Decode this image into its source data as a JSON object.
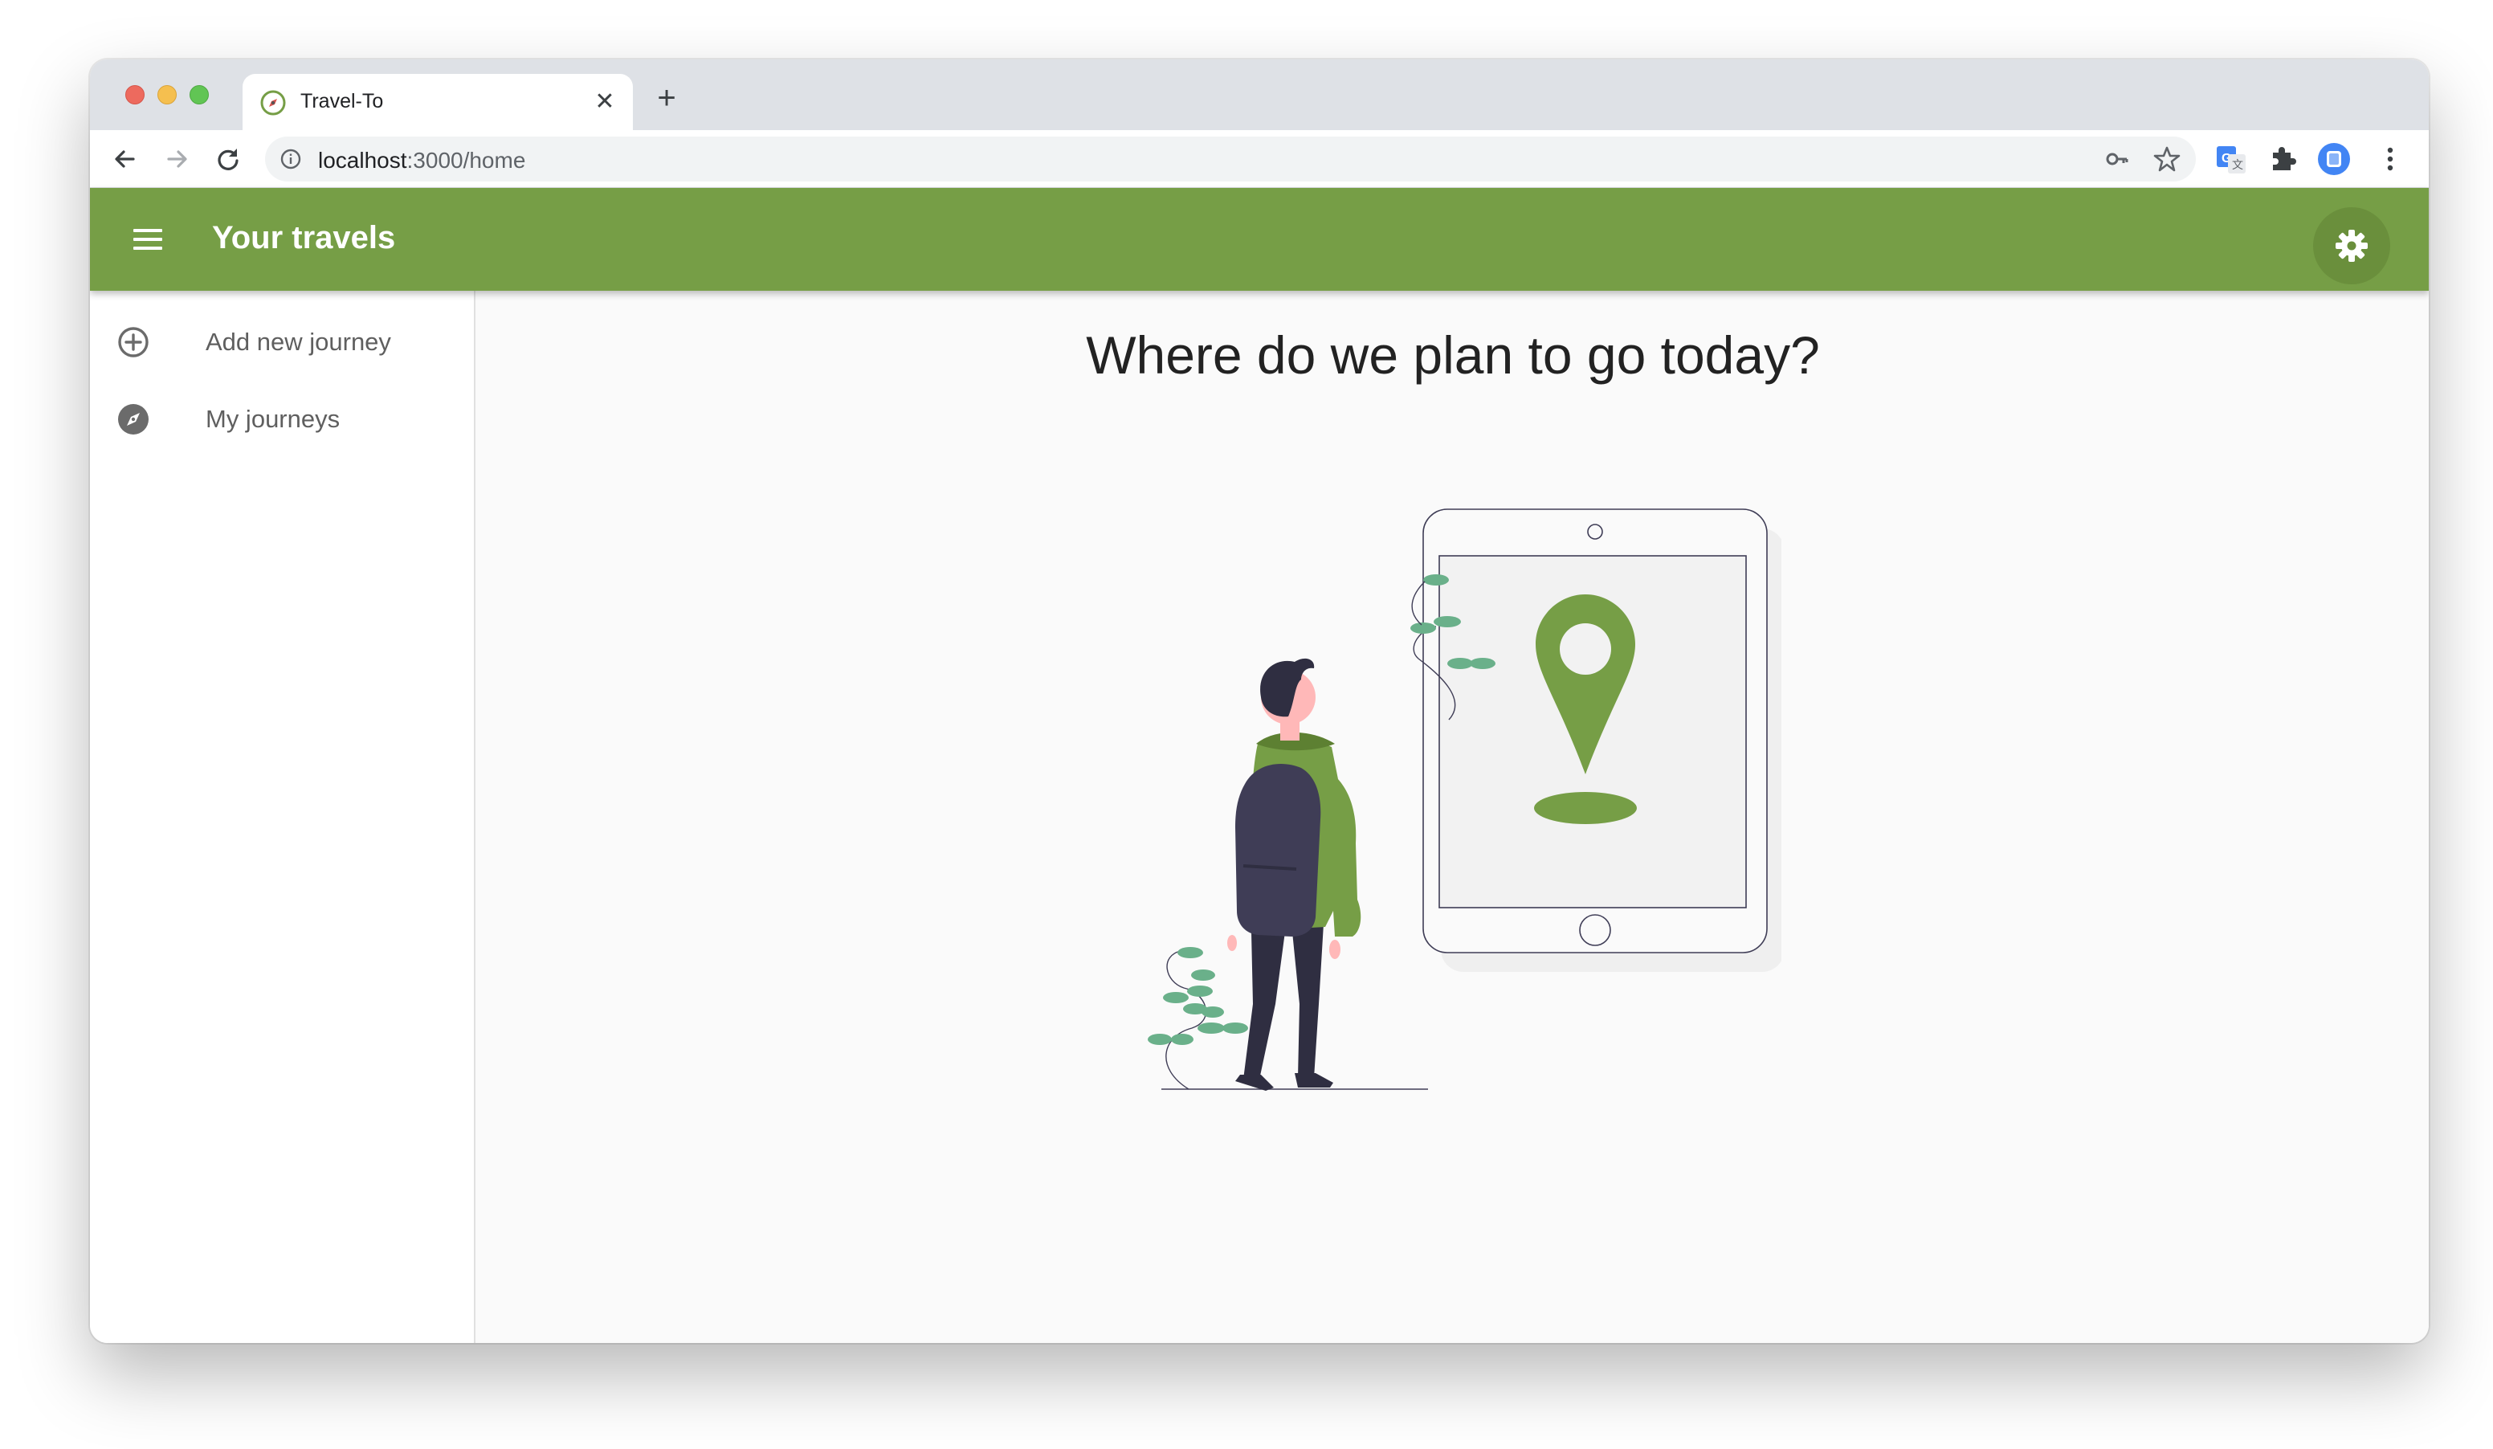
{
  "browser": {
    "tab_title": "Travel-To",
    "tab_close": "✕",
    "new_tab": "+",
    "url_host": "localhost",
    "url_path": ":3000/home"
  },
  "app": {
    "title": "Your travels",
    "accent_color": "#769e46"
  },
  "sidebar": {
    "items": [
      {
        "label": "Add new journey",
        "icon": "add-circle-icon"
      },
      {
        "label": "My journeys",
        "icon": "compass-icon"
      }
    ]
  },
  "main": {
    "headline": "Where do we plan to go today?"
  }
}
